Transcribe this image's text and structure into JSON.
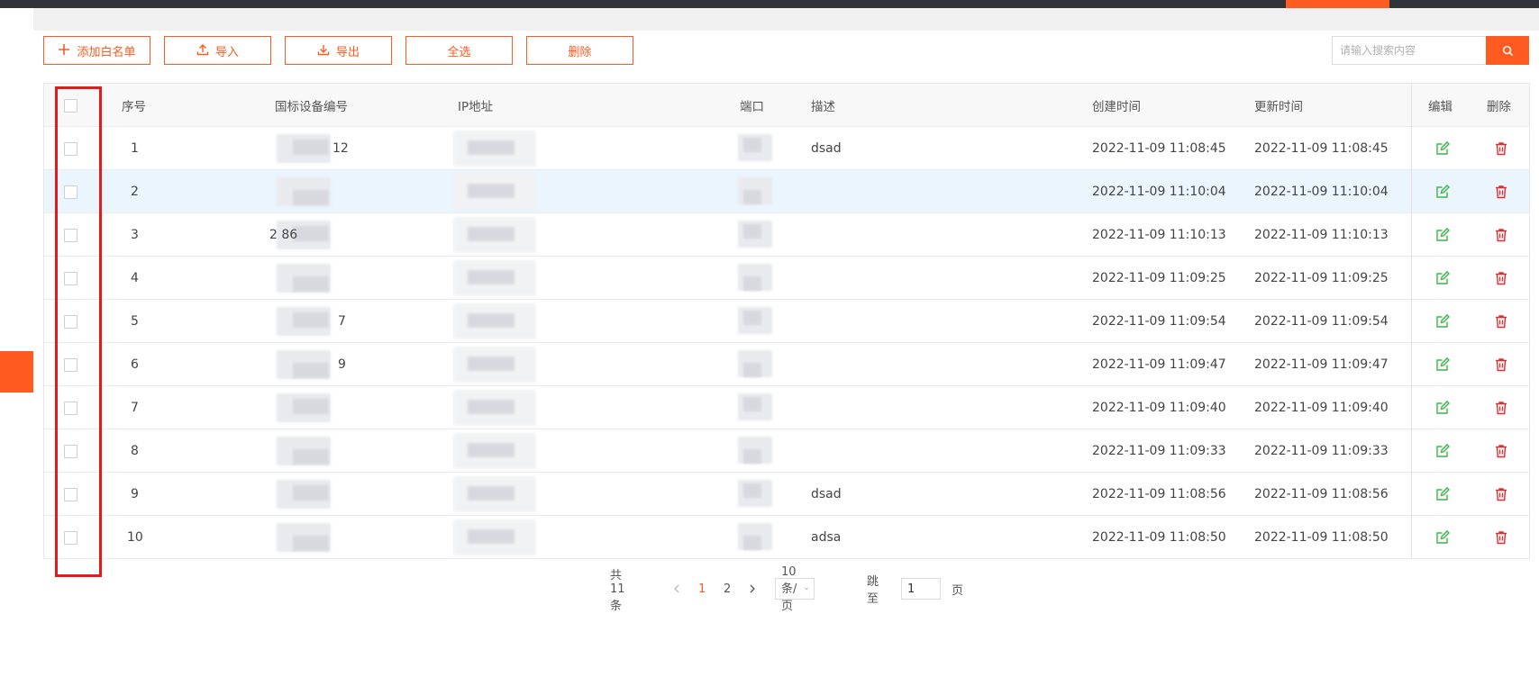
{
  "toolbar": {
    "add_label": "添加白名单",
    "import_label": "导入",
    "export_label": "导出",
    "select_all_label": "全选",
    "delete_label": "删除"
  },
  "search": {
    "placeholder": "请输入搜索内容",
    "icon": "search-icon"
  },
  "table": {
    "headers": {
      "index": "序号",
      "device_code": "国标设备编号",
      "ip": "IP地址",
      "port": "端口",
      "description": "描述",
      "created": "创建时间",
      "updated": "更新时间",
      "edit": "编辑",
      "delete": "删除"
    },
    "rows": [
      {
        "index": "1",
        "device_code": "12",
        "port": "",
        "description": "dsad",
        "created": "2022-11-09 11:08:45",
        "updated": "2022-11-09 11:08:45"
      },
      {
        "index": "2",
        "device_code": "",
        "port": "",
        "description": "",
        "created": "2022-11-09 11:10:04",
        "updated": "2022-11-09 11:10:04"
      },
      {
        "index": "3",
        "device_code": "2         86",
        "port": "",
        "description": "",
        "created": "2022-11-09 11:10:13",
        "updated": "2022-11-09 11:10:13"
      },
      {
        "index": "4",
        "device_code": "",
        "port": "",
        "description": "",
        "created": "2022-11-09 11:09:25",
        "updated": "2022-11-09 11:09:25"
      },
      {
        "index": "5",
        "device_code": "7",
        "port": "",
        "description": "",
        "created": "2022-11-09 11:09:54",
        "updated": "2022-11-09 11:09:54"
      },
      {
        "index": "6",
        "device_code": "9",
        "port": "",
        "description": "",
        "created": "2022-11-09 11:09:47",
        "updated": "2022-11-09 11:09:47"
      },
      {
        "index": "7",
        "device_code": "",
        "port": "",
        "description": "",
        "created": "2022-11-09 11:09:40",
        "updated": "2022-11-09 11:09:40"
      },
      {
        "index": "8",
        "device_code": "",
        "port": "",
        "description": "",
        "created": "2022-11-09 11:09:33",
        "updated": "2022-11-09 11:09:33"
      },
      {
        "index": "9",
        "device_code": "",
        "port": "",
        "description": "dsad",
        "created": "2022-11-09 11:08:56",
        "updated": "2022-11-09 11:08:56"
      },
      {
        "index": "10",
        "device_code": "",
        "port": "",
        "description": "adsa",
        "created": "2022-11-09 11:08:50",
        "updated": "2022-11-09 11:08:50"
      }
    ],
    "highlighted_row": 2
  },
  "pagination": {
    "total": "共 11 条",
    "pages": [
      "1",
      "2"
    ],
    "current_page": "1",
    "page_size": "10 条/页",
    "jump_label": "跳至",
    "jump_value": "1",
    "page_suffix": "页"
  },
  "colors": {
    "accent": "#ff5a1f",
    "edit": "#3bb54a",
    "delete": "#e8292b",
    "highlight_row": "#eaf5fd",
    "annotation_box": "#e31b1b"
  }
}
